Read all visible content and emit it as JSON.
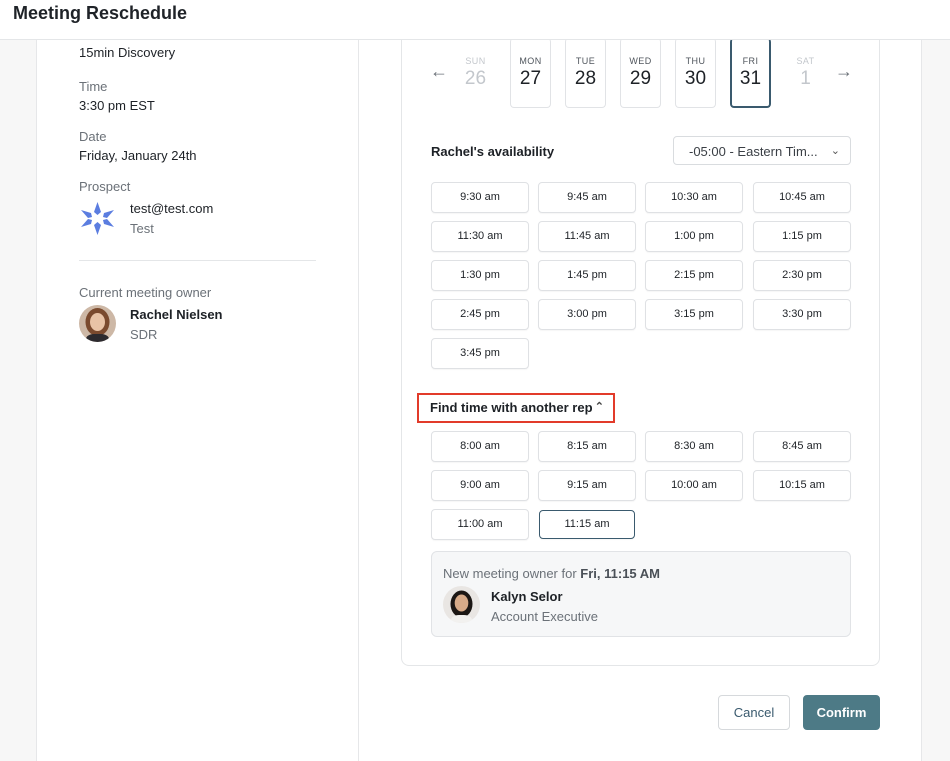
{
  "header": {
    "title": "Meeting Reschedule"
  },
  "details": {
    "meeting_type_value": "15min Discovery",
    "time_label": "Time",
    "time_value": "3:30 pm EST",
    "date_label": "Date",
    "date_value": "Friday, January 24th",
    "prospect_label": "Prospect",
    "prospect_email": "test@test.com",
    "prospect_company": "Test",
    "owner_label": "Current meeting owner",
    "owner_name": "Rachel Nielsen",
    "owner_role": "SDR"
  },
  "calendar": {
    "days": [
      {
        "dow": "SUN",
        "num": "26"
      },
      {
        "dow": "MON",
        "num": "27"
      },
      {
        "dow": "TUE",
        "num": "28"
      },
      {
        "dow": "WED",
        "num": "29"
      },
      {
        "dow": "THU",
        "num": "30"
      },
      {
        "dow": "FRI",
        "num": "31"
      },
      {
        "dow": "SAT",
        "num": "1"
      }
    ],
    "prev_icon": "arrow-left-icon",
    "next_icon": "arrow-right-icon"
  },
  "availability": {
    "label": "Rachel's availability",
    "timezone": "-05:00 - Eastern Tim...",
    "slots": [
      "9:30 am",
      "9:45 am",
      "10:30 am",
      "10:45 am",
      "11:30 am",
      "11:45 am",
      "1:00 pm",
      "1:15 pm",
      "1:30 pm",
      "1:45 pm",
      "2:15 pm",
      "2:30 pm",
      "2:45 pm",
      "3:00 pm",
      "3:15 pm",
      "3:30 pm",
      "3:45 pm"
    ]
  },
  "other_rep": {
    "label": "Find time with another rep",
    "slots": [
      "8:00 am",
      "8:15 am",
      "8:30 am",
      "8:45 am",
      "9:00 am",
      "9:15 am",
      "10:00 am",
      "10:15 am",
      "11:00 am",
      "11:15 am"
    ],
    "selected_slot": "11:15 am"
  },
  "new_owner": {
    "prefix": "New meeting owner for",
    "when": "Fri, 11:15 AM",
    "name": "Kalyn Selor",
    "role": "Account Executive"
  },
  "actions": {
    "cancel": "Cancel",
    "confirm": "Confirm"
  },
  "colors": {
    "accent": "#4d7a86",
    "highlight": "#e23b2a",
    "logo": "#5b7de0"
  }
}
